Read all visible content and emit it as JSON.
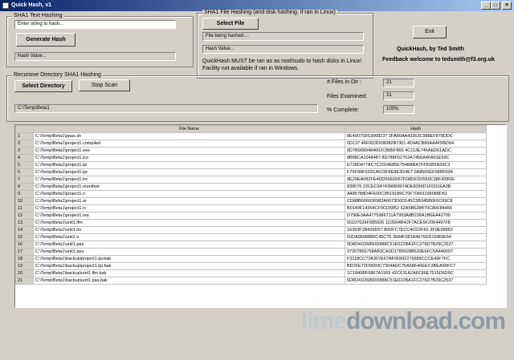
{
  "window": {
    "title": "Quick Hash, v1",
    "buttons": [
      "_",
      "□",
      "×"
    ]
  },
  "text_hashing": {
    "group_label": "SHA1 Text Hashing",
    "input_value": "Enter string to hash...",
    "generate_label": "Generate Hash",
    "hash_value": "Hash Value..."
  },
  "file_hashing": {
    "group_label": "SHA1 File Hashing (and disk hashing, if ran in Linux)",
    "select_file_label": "Select File",
    "file_status": "File being hashed....",
    "hash_value": "Hash Value...",
    "note": "QuickHash MUST be ran as as root/sudo to hash disks in Linux! Facility not available if ran in Windows."
  },
  "exit": {
    "label": "Exit"
  },
  "credits": {
    "line1": "QuickHash, by Ted Smith",
    "line2": "Feedback welcome to tedsmith@f3.org.uk"
  },
  "dir_hashing": {
    "group_label": "Recursive Directory SHA1  Hashing",
    "select_directory_label": "Select Directory",
    "stop_scan_label": "Stop Scan",
    "path": "C:\\Temp\\Beta1",
    "files_in_dir_label": "# Files in Dir :",
    "files_in_dir_value": "21",
    "files_examined_label": "Files Examined:",
    "files_examined_value": "21",
    "percent_label": "% Complete:",
    "percent_value": "100%"
  },
  "table": {
    "columns": [
      "",
      "File Name",
      "Hash"
    ],
    "rows": [
      [
        "1",
        "C:\\Temp\\Beta1\\ppas.sh",
        "8E4907SF53068237 2FA80AA43363C988EF878DDC"
      ],
      [
        "2",
        "C:\\Temp\\Beta1\\project1.compiled",
        "6D137 46F0D3D08D82B7301 4D4ACB86AA4F5BD94"
      ],
      [
        "3",
        "C:\\Temp\\Beta1\\project1.exe",
        "9D7B9089484002CB85F866 4C113E746AED61ADC"
      ],
      [
        "4",
        "C:\\Temp\\Beta1\\project1.ico",
        "8B88CA1048487 8D788F52763A7456A40A01E59C"
      ],
      [
        "5",
        "C:\\Temp\\Beta1\\project1.lpi",
        "E728D477AC7C2024685E7548ABA7FF81B5A39C3"
      ],
      [
        "6",
        "C:\\Temp\\Beta1\\project1.lpr",
        "F70F99F033CA519F8E8E3D4E7 0A8506EF098D034"
      ],
      [
        "7",
        "C:\\Temp\\Beta1\\project1.lrs",
        "8E29EA082FE4DD566D067FD8DFD0550C38F439DE"
      ],
      [
        "8",
        "C:\\Temp\\Beta1\\project1.manifest",
        "838076 22CEC9474396B8974DE8396D1FD31EA3B"
      ],
      [
        "9",
        "C:\\Temp\\Beta1\\project1.o",
        "A485788D4FE00C3B19189C70F70491199088D61"
      ],
      [
        "10",
        "C:\\Temp\\Beta1\\project1.or",
        "CD88B606930982A6673D6D145C5B345B0F6C69C8"
      ],
      [
        "11",
        "C:\\Temp\\Beta1\\project1.rc",
        "B0140F14364CF9CD5852 62A5B628B70C80F84456"
      ],
      [
        "12",
        "C:\\Temp\\Beta1\\project1.res",
        "D790E3AA4775986711A7993A8B228A1B6EA42700"
      ],
      [
        "13",
        "C:\\Temp\\Beta1\\unit1.lfm",
        "65107639F585926 1D3004B42F7ACE5F2954497F8"
      ],
      [
        "14",
        "C:\\Temp\\Beta1\\unit1.lrs",
        "16393F1B429D57 80DFC7ECC4CD3F81 3F0E09852"
      ],
      [
        "15",
        "C:\\Temp\\Beta1\\unit1.o",
        "55DA9690886C45C75 3684F081A4676DD1DBDE54"
      ],
      [
        "16",
        "C:\\Temp\\Beta1\\unit1.pas",
        "5D8D41D6890D888C51E022BA1FC276D7B29C2537"
      ],
      [
        "17",
        "C:\\Temp\\Beta1\\unit1.ppu",
        "97207865758AB3CA3D1789028B633E6FC5A440097"
      ],
      [
        "18",
        "C:\\Temp\\Beta1\\backup\\project1.lpi.bak",
        "F3118CC72A307E67AF06992276689CCCE49F7FC"
      ],
      [
        "19",
        "C:\\Temp\\Beta1\\backup\\project1.lpr.bak",
        "BD2FE72D9093C7304ADC75A68F46EEC3BEA99FC7"
      ],
      [
        "20",
        "C:\\Temp\\Beta1\\backup\\unit1.lfm.bak",
        "1C1845BF0867A1959 42C631A2A6C86E7515D6D9C"
      ],
      [
        "21",
        "C:\\Temp\\Beta1\\backup\\unit1.pas.bak",
        "5D8D41D6890D888C51E022BA1FC276D7B29C2537"
      ]
    ]
  },
  "watermark": {
    "part1": "lime",
    "part2": "download.com"
  }
}
